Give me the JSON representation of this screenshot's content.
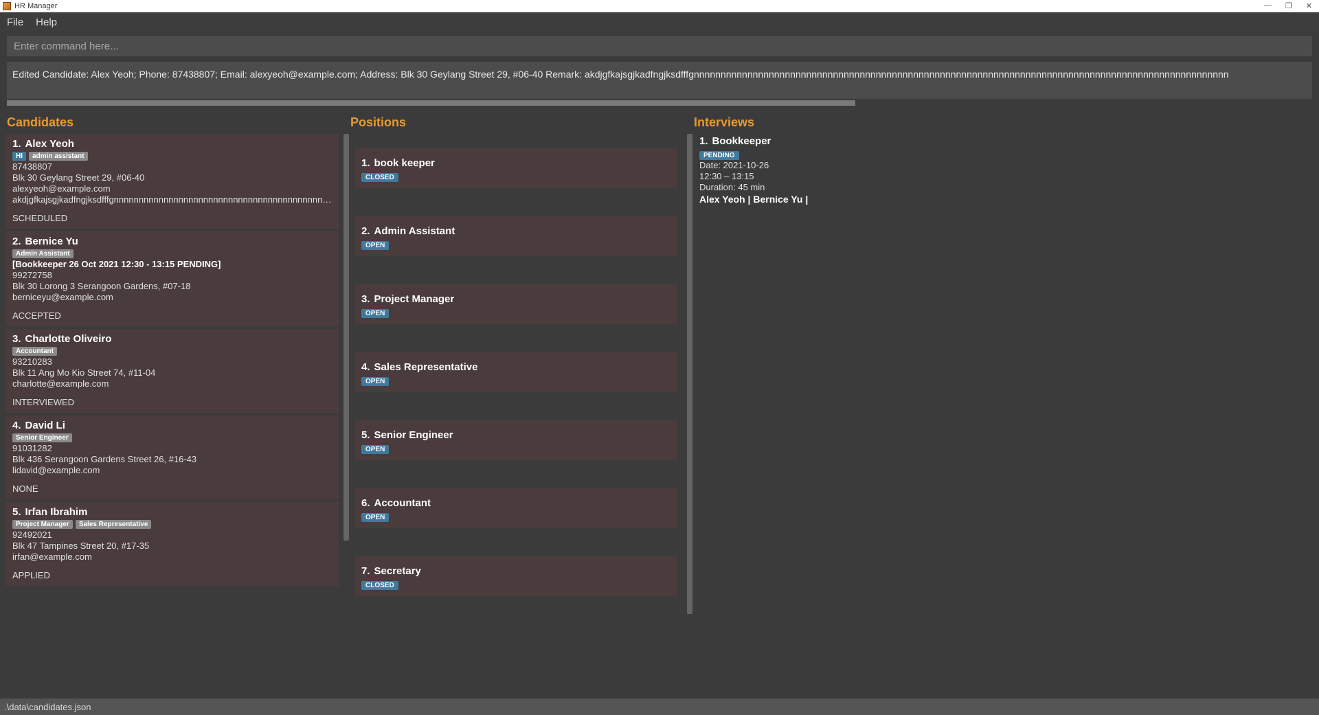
{
  "window": {
    "title": "HR Manager",
    "controls": {
      "min": "—",
      "max": "❐",
      "close": "✕"
    }
  },
  "menu": {
    "file": "File",
    "help": "Help"
  },
  "command": {
    "placeholder": "Enter command here..."
  },
  "result": {
    "text": "Edited Candidate: Alex Yeoh; Phone: 87438807; Email: alexyeoh@example.com; Address: Blk 30 Geylang Street 29, #06-40 Remark: akdjgfkajsgjkadfngjksdfffgnnnnnnnnnnnnnnnnnnnnnnnnnnnnnnnnnnnnnnnnnnnnnnnnnnnnnnnnnnnnnnnnnnnnnnnnnnnnnnnnnnnnnnnnnnnnnnnnnnnn"
  },
  "headings": {
    "candidates": "Candidates",
    "positions": "Positions",
    "interviews": "Interviews"
  },
  "candidates": [
    {
      "idx": "1.",
      "name": "Alex Yeoh",
      "tags": [
        {
          "label": "HI",
          "style": "blue"
        },
        {
          "label": "admin assistant",
          "style": "grey"
        }
      ],
      "lines": [
        "87438807",
        "Blk 30 Geylang Street 29, #06-40",
        "alexyeoh@example.com",
        "akdjgfkajsgjkadfngjksdfffgnnnnnnnnnnnnnnnnnnnnnnnnnnnnnnnnnnnnnnnnnnnnnnnnn..."
      ],
      "status": "SCHEDULED"
    },
    {
      "idx": "2.",
      "name": "Bernice Yu",
      "tags": [
        {
          "label": "Admin Assistant",
          "style": "grey"
        }
      ],
      "boldline": "[Bookkeeper 26 Oct 2021 12:30 - 13:15 PENDING]",
      "lines": [
        "99272758",
        "Blk 30 Lorong 3 Serangoon Gardens, #07-18",
        "berniceyu@example.com"
      ],
      "status": "ACCEPTED"
    },
    {
      "idx": "3.",
      "name": "Charlotte Oliveiro",
      "tags": [
        {
          "label": "Accountant",
          "style": "grey"
        }
      ],
      "lines": [
        "93210283",
        "Blk 11 Ang Mo Kio Street 74, #11-04",
        "charlotte@example.com"
      ],
      "status": "INTERVIEWED"
    },
    {
      "idx": "4.",
      "name": "David Li",
      "tags": [
        {
          "label": "Senior Engineer",
          "style": "grey"
        }
      ],
      "lines": [
        "91031282",
        "Blk 436 Serangoon Gardens Street 26, #16-43",
        "lidavid@example.com"
      ],
      "status": "NONE"
    },
    {
      "idx": "5.",
      "name": "Irfan Ibrahim",
      "tags": [
        {
          "label": "Project Manager",
          "style": "grey"
        },
        {
          "label": "Sales Representative",
          "style": "grey"
        }
      ],
      "lines": [
        "92492021",
        "Blk 47 Tampines Street 20, #17-35",
        "irfan@example.com"
      ],
      "status": "APPLIED"
    }
  ],
  "positions": [
    {
      "idx": "1.",
      "title": "book keeper",
      "status": "CLOSED"
    },
    {
      "idx": "2.",
      "title": "Admin Assistant",
      "status": "OPEN"
    },
    {
      "idx": "3.",
      "title": "Project Manager",
      "status": "OPEN"
    },
    {
      "idx": "4.",
      "title": "Sales Representative",
      "status": "OPEN"
    },
    {
      "idx": "5.",
      "title": "Senior Engineer",
      "status": "OPEN"
    },
    {
      "idx": "6.",
      "title": "Accountant",
      "status": "OPEN"
    },
    {
      "idx": "7.",
      "title": "Secretary",
      "status": "CLOSED"
    }
  ],
  "interviews": [
    {
      "idx": "1.",
      "title": "Bookkeeper",
      "badge": "PENDING",
      "date": "Date: 2021-10-26",
      "time": "12:30 – 13:15",
      "duration": "Duration: 45 min",
      "people": "Alex Yeoh | Bernice Yu |"
    }
  ],
  "statusbar": ".\\data\\candidates.json"
}
